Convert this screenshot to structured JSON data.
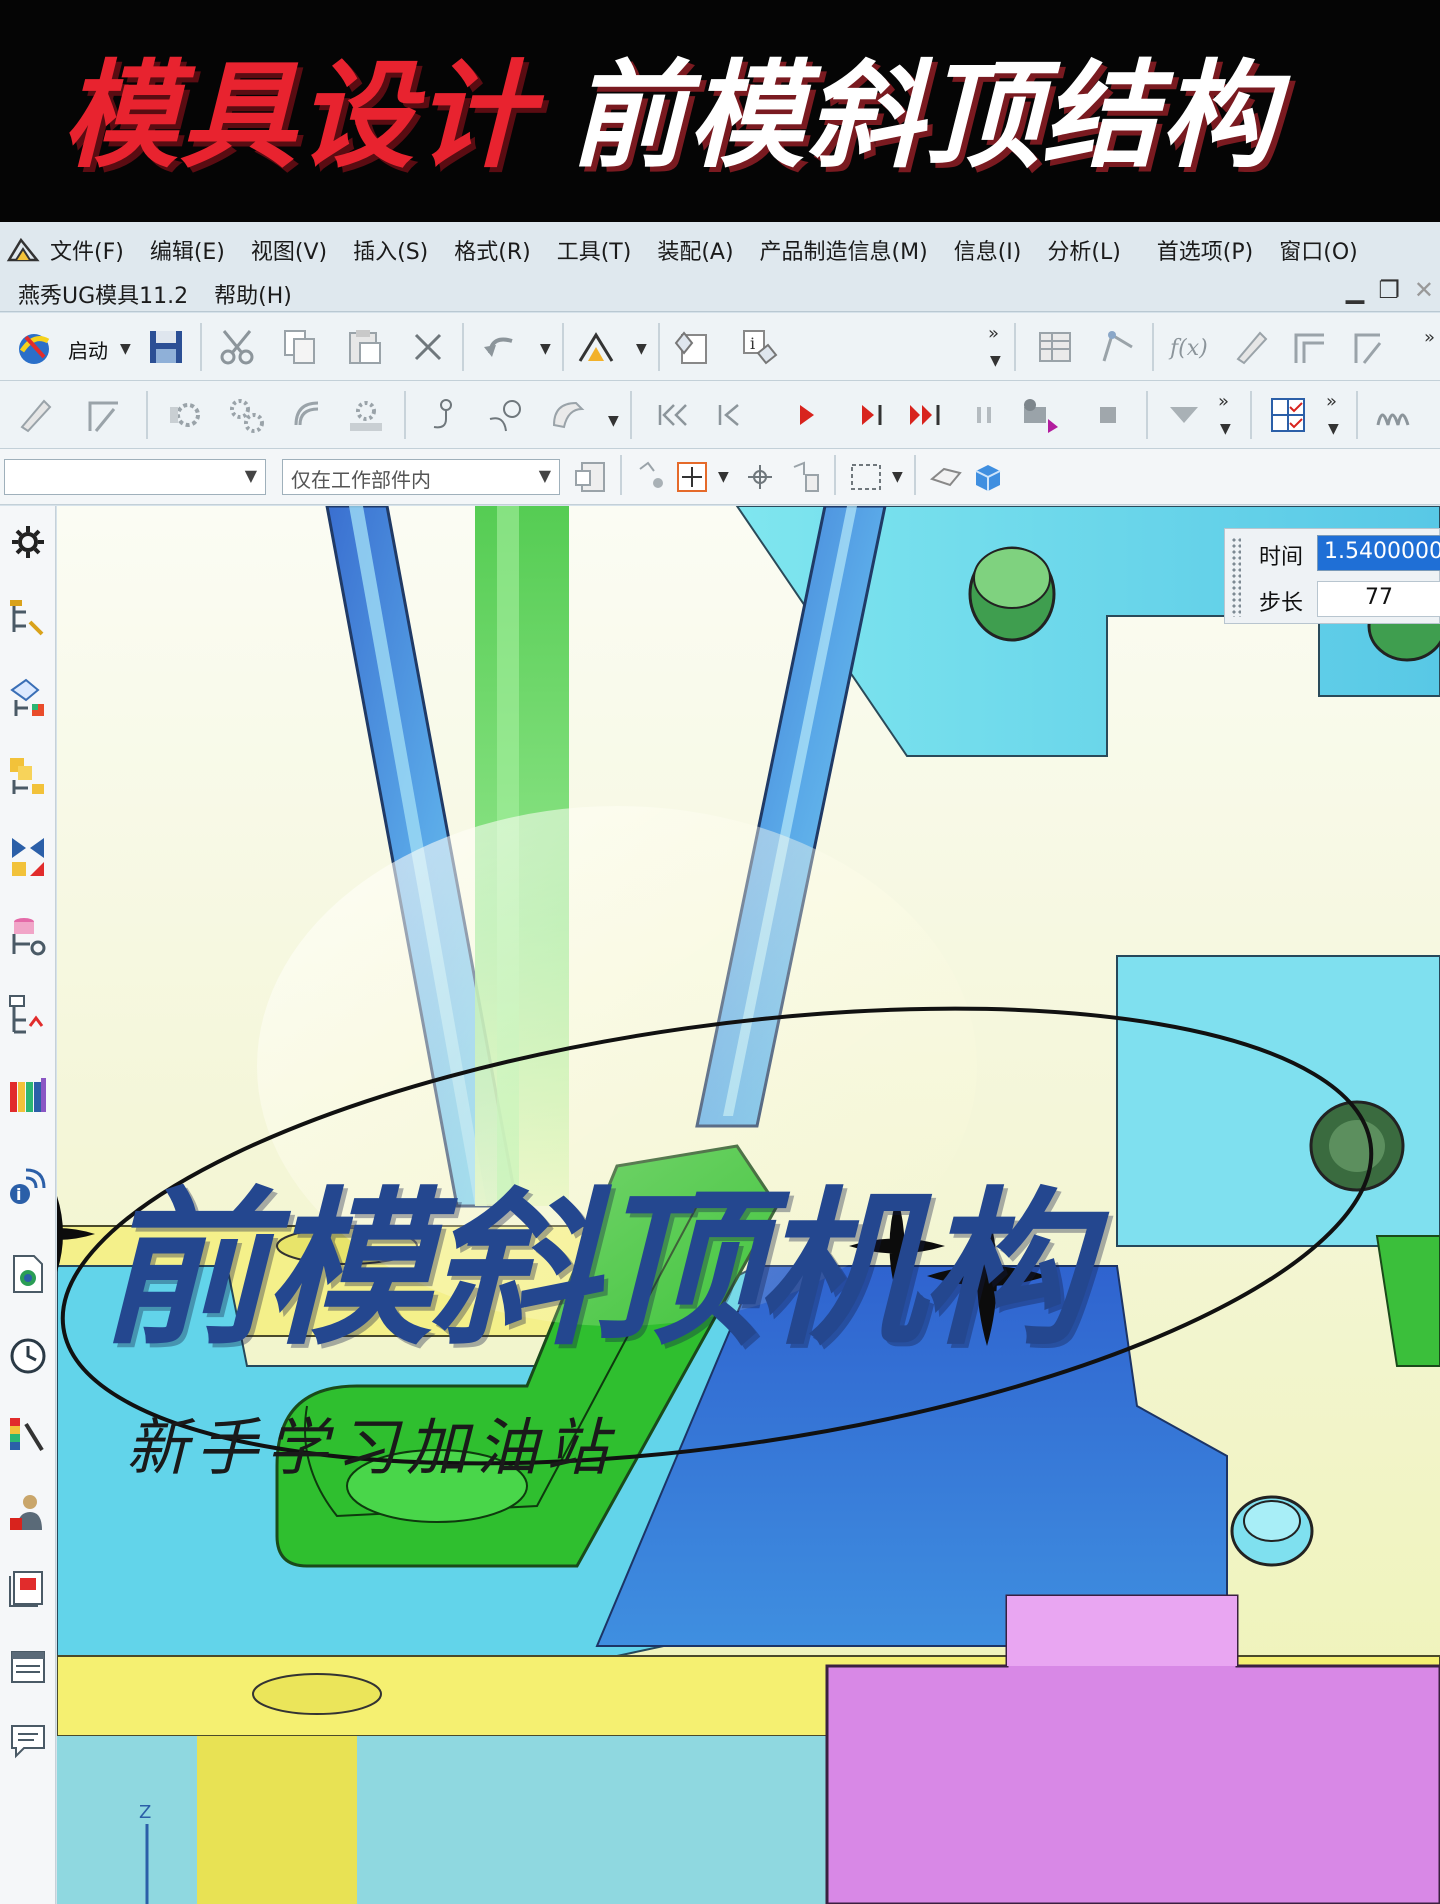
{
  "banner": {
    "title_red": "模具设计",
    "title_white": "前模斜顶结构",
    "colors": {
      "red": "#e8232f",
      "white": "#ffffff"
    }
  },
  "menubar": {
    "items": [
      "文件(F)",
      "编辑(E)",
      "视图(V)",
      "插入(S)",
      "格式(R)",
      "工具(T)",
      "装配(A)",
      "产品制造信息(M)",
      "信息(I)",
      "分析(L)",
      "首选项(P)",
      "窗口(O)"
    ],
    "row2": [
      "燕秀UG模具11.2",
      "帮助(H)"
    ]
  },
  "toolbar": {
    "start_label": "启动",
    "filter_combo": "",
    "scope_combo": "仅在工作部件内"
  },
  "simulation": {
    "time_label": "时间",
    "time_value": "1.5400000",
    "step_label": "步长",
    "step_value": "77"
  },
  "overlay": {
    "title": "前模斜顶机构",
    "subtitle": "新手学习加油站"
  },
  "icons": [
    "app-icon",
    "start-icon",
    "save-icon",
    "cut-icon",
    "copy-icon",
    "paste-icon",
    "delete-icon",
    "undo-icon",
    "reset-icon",
    "first-frame-icon",
    "prev-frame-icon",
    "play-icon",
    "next-frame-icon",
    "last-frame-icon",
    "pause-icon",
    "record-icon",
    "stop-icon",
    "gear-icon"
  ]
}
